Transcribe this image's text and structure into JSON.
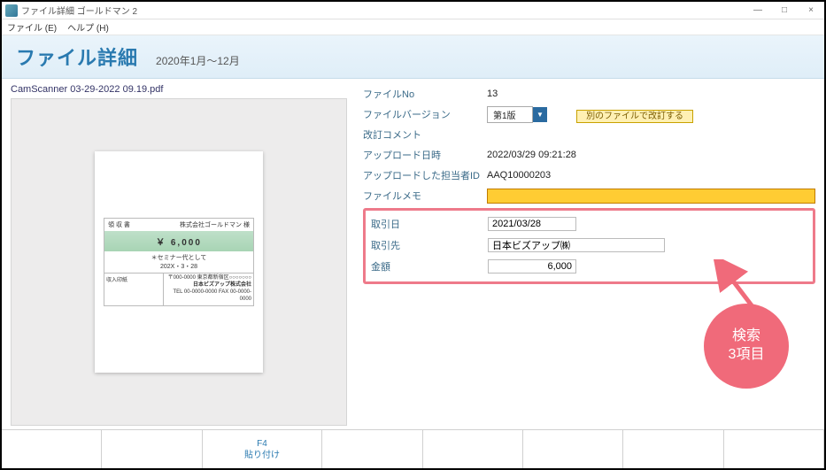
{
  "window": {
    "title": "ファイル詳細 ゴールドマン 2",
    "minimize": "—",
    "maximize": "□",
    "close": "×"
  },
  "menu": {
    "file": "ファイル (E)",
    "help": "ヘルプ (H)"
  },
  "header": {
    "title": "ファイル詳細",
    "period": "2020年1月～12月"
  },
  "file": {
    "name": "CamScanner 03-29-2022 09.19.pdf"
  },
  "receipt": {
    "top_left": "領 収 書",
    "top_right": "株式会社ゴールドマン   様",
    "amount": "￥ 6,000",
    "desc1": "＊セミナー代として",
    "desc2": "202X・3・28",
    "addr1": "〒000-0000 東京都新宿区○○○○○○○",
    "addr2": "日本ビズアップ株式会社",
    "stamp": "収入印紙",
    "tel": "TEL 00-0000-0000 FAX 00-0000-0000"
  },
  "fields": {
    "fileNo": {
      "label": "ファイルNo",
      "value": "13"
    },
    "version": {
      "label": "ファイルバージョン",
      "value": "第1版"
    },
    "reviseBtn": "別のファイルで改訂する",
    "reviseComment": {
      "label": "改訂コメント",
      "value": ""
    },
    "uploadDate": {
      "label": "アップロード日時",
      "value": "2022/03/29 09:21:28"
    },
    "uploaderId": {
      "label": "アップロードした担当者ID",
      "value": "AAQ10000203"
    },
    "memo": {
      "label": "ファイルメモ",
      "value": ""
    },
    "txnDate": {
      "label": "取引日",
      "value": "2021/03/28"
    },
    "partner": {
      "label": "取引先",
      "value": "日本ビズアップ㈱"
    },
    "amount": {
      "label": "金額",
      "value": "6,000"
    }
  },
  "callout": {
    "line1": "検索",
    "line2": "3項目"
  },
  "footer": {
    "f4_key": "F4",
    "f4_label": "貼り付け"
  }
}
